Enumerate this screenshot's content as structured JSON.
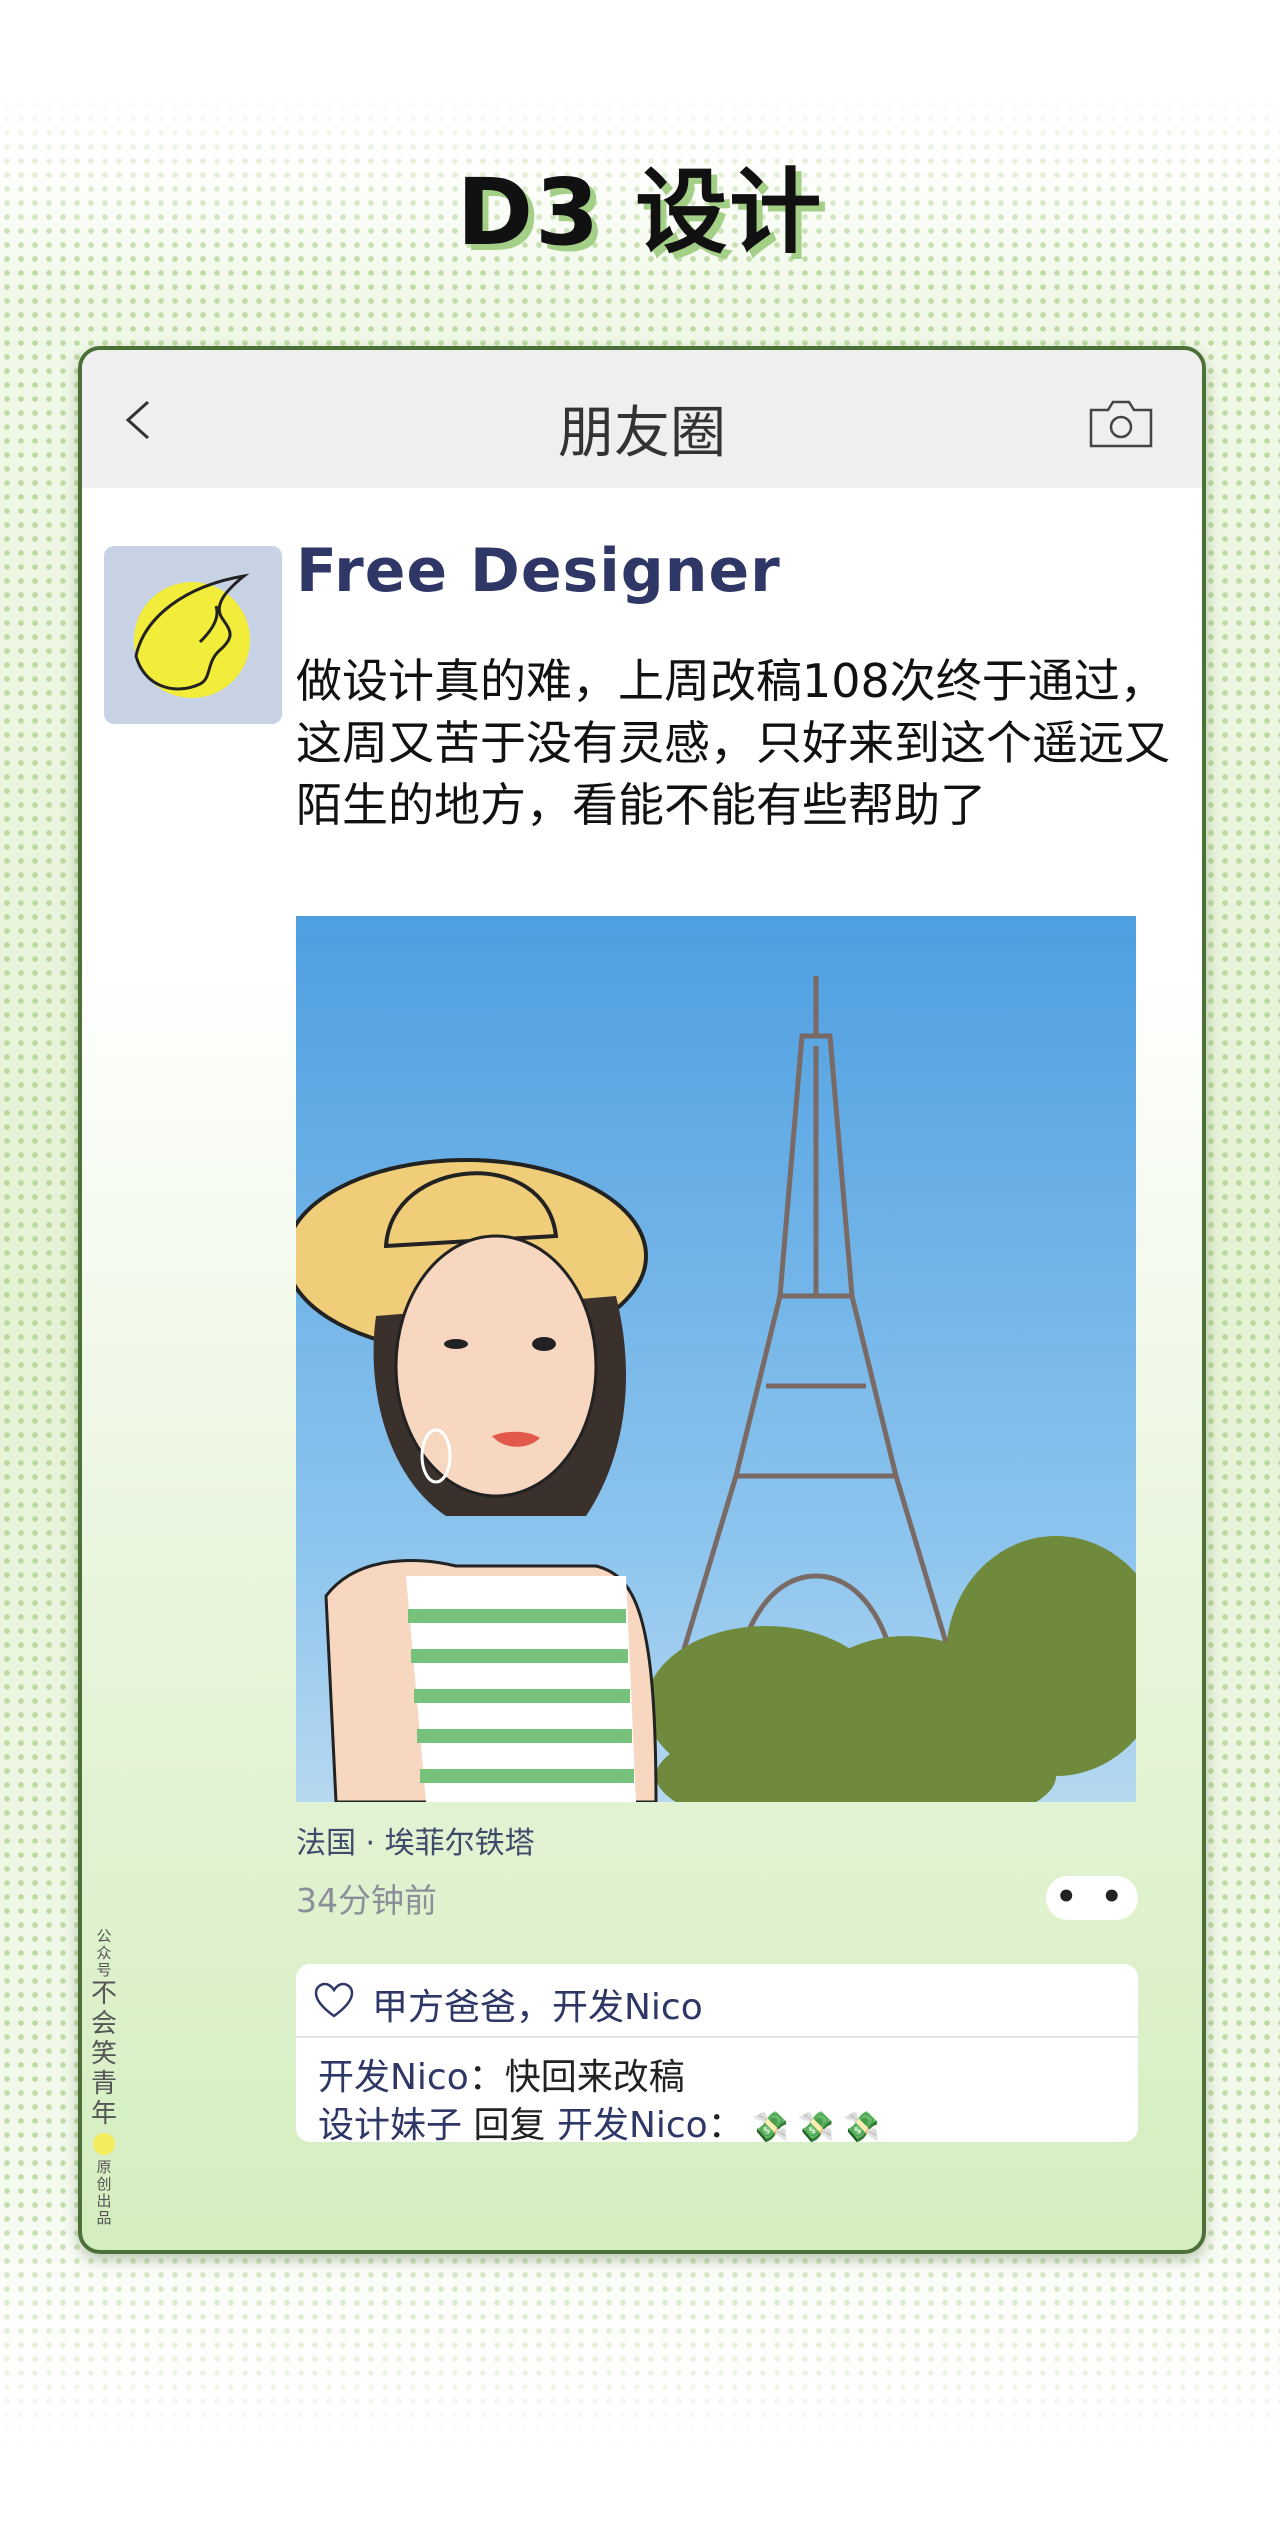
{
  "page_title": "D3 设计",
  "nav": {
    "title": "朋友圈",
    "back_icon": "chevron-left-icon",
    "camera_icon": "camera-icon"
  },
  "post": {
    "user_name": "Free Designer",
    "text": "做设计真的难，上周改稿108次终于通过，这周又苦于没有灵感，只好来到这个遥远又陌生的地方，看能不能有些帮助了",
    "location": "法国 · 埃菲尔铁塔",
    "time_ago": "34分钟前",
    "more_label": "• •"
  },
  "interaction": {
    "likes": "甲方爸爸，开发Nico",
    "comments": [
      {
        "name": "开发Nico",
        "separator": "：",
        "text": "快回来改稿"
      },
      {
        "name": "设计妹子",
        "reply_word": "回复",
        "to": "开发Nico",
        "separator": "：",
        "emojis": [
          "💸",
          "💸",
          "💸"
        ]
      }
    ]
  },
  "watermark": {
    "top": "公众号",
    "name": [
      "不",
      "会",
      "笑",
      "青",
      "年"
    ],
    "bottom": "原创出品"
  },
  "colors": {
    "accent_green": "#4d6f38",
    "name_blue": "#2f3766",
    "sky": "#6fb4e6"
  }
}
